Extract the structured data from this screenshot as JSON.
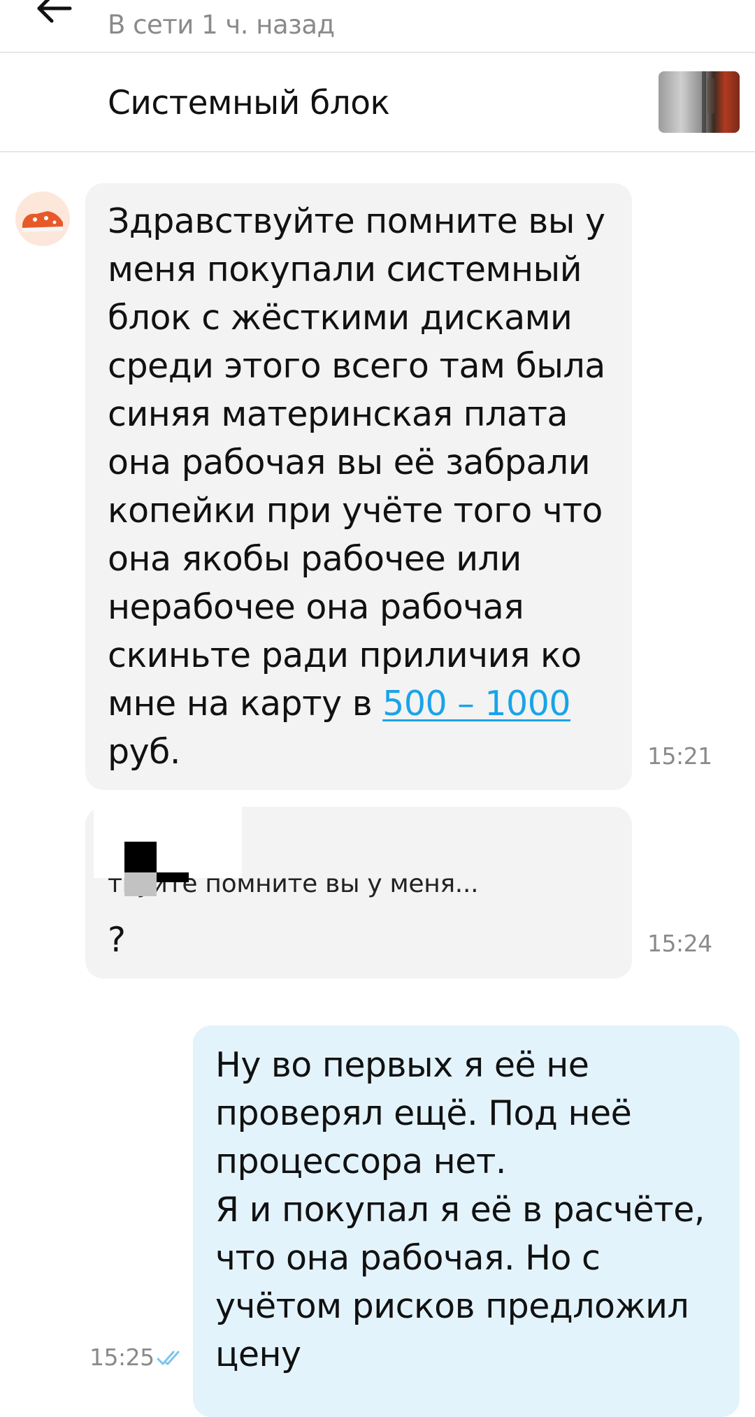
{
  "header": {
    "status": "В сети 1 ч. назад"
  },
  "listing": {
    "title": "Системный блок"
  },
  "messages": [
    {
      "text_before": "Здравствуйте помните вы у\nменя покупали системный\nблок с жёсткими дисками\nсреди этого всего там была\nсиняя материнская плата\nона рабочая вы её забрали\nкопейки при учёте того что\nона якобы рабочее или\nнерабочее она рабочая\nскиньте ради приличия ко\nмне на карту в ",
      "link": "500 – 1000",
      "text_after": "\nруб.",
      "time": "15:21"
    },
    {
      "quote": "твуйте помните вы у меня...",
      "text": "?",
      "time": "15:24"
    },
    {
      "text": "Ну во первых я её не\nпроверял ещё. Под неё\nпроцессора нет.\nЯ и покупал я её в расчёте,\nчто она рабочая. Но с\nучётом рисков предложил\nцену",
      "time": "15:25"
    }
  ],
  "colors": {
    "incoming_bubble": "#f3f3f3",
    "outgoing_bubble": "#e3f3fc",
    "link": "#1aa3e8",
    "read_check": "#7cc4ef"
  },
  "icons": [
    "back-arrow-icon",
    "seller-avatar",
    "listing-thumbnail",
    "read-check-icon"
  ]
}
